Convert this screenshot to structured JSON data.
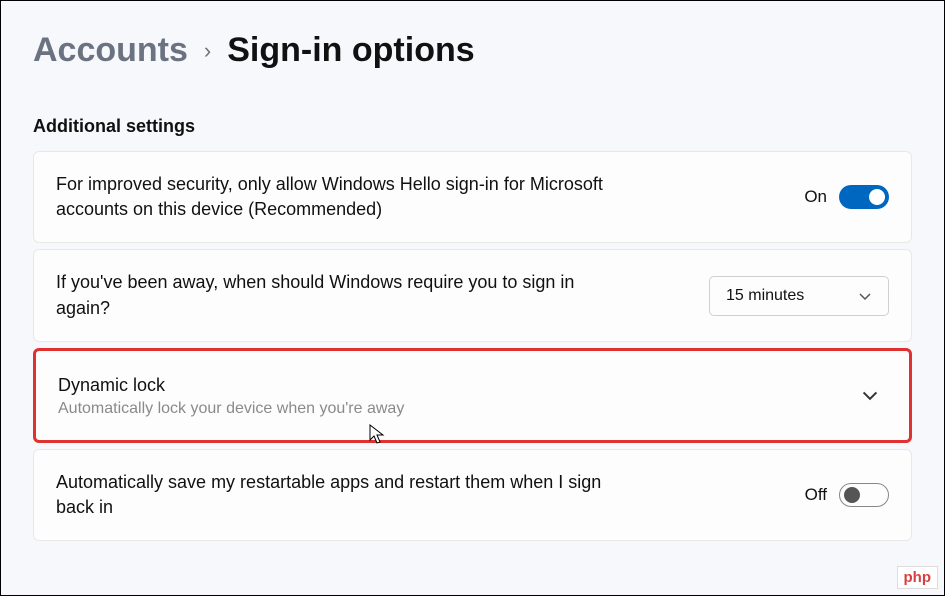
{
  "breadcrumb": {
    "parent": "Accounts",
    "current": "Sign-in options"
  },
  "section_header": "Additional settings",
  "settings": {
    "hello": {
      "title": "For improved security, only allow Windows Hello sign-in for Microsoft accounts on this device (Recommended)",
      "state_label": "On"
    },
    "away": {
      "title": "If you've been away, when should Windows require you to sign in again?",
      "selected": "15 minutes"
    },
    "dynamic_lock": {
      "title": "Dynamic lock",
      "subtitle": "Automatically lock your device when you're away"
    },
    "restartable": {
      "title": "Automatically save my restartable apps and restart them when I sign back in",
      "state_label": "Off"
    }
  },
  "watermark": "php"
}
